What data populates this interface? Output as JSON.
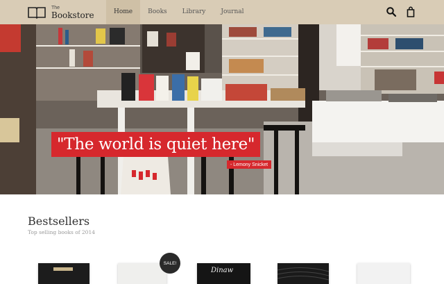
{
  "brand": {
    "small": "The",
    "name": "Bookstore"
  },
  "nav": {
    "items": [
      {
        "label": "Home",
        "active": true
      },
      {
        "label": "Books",
        "active": false
      },
      {
        "label": "Library",
        "active": false
      },
      {
        "label": "Journal",
        "active": false
      }
    ]
  },
  "header_icons": [
    "search-icon",
    "shopping-bag-icon"
  ],
  "hero": {
    "quote": "\"The world is quiet here\"",
    "author": "- Lemony Snicket",
    "accent_color": "#d6282d"
  },
  "bestsellers": {
    "title": "Bestsellers",
    "subtitle": "Top selling books of 2014",
    "badge": "SALE!",
    "book3_cover_text": "Dinaw"
  },
  "colors": {
    "header_bg": "#d9ccb6",
    "nav_active_bg": "#cfc0a6"
  }
}
